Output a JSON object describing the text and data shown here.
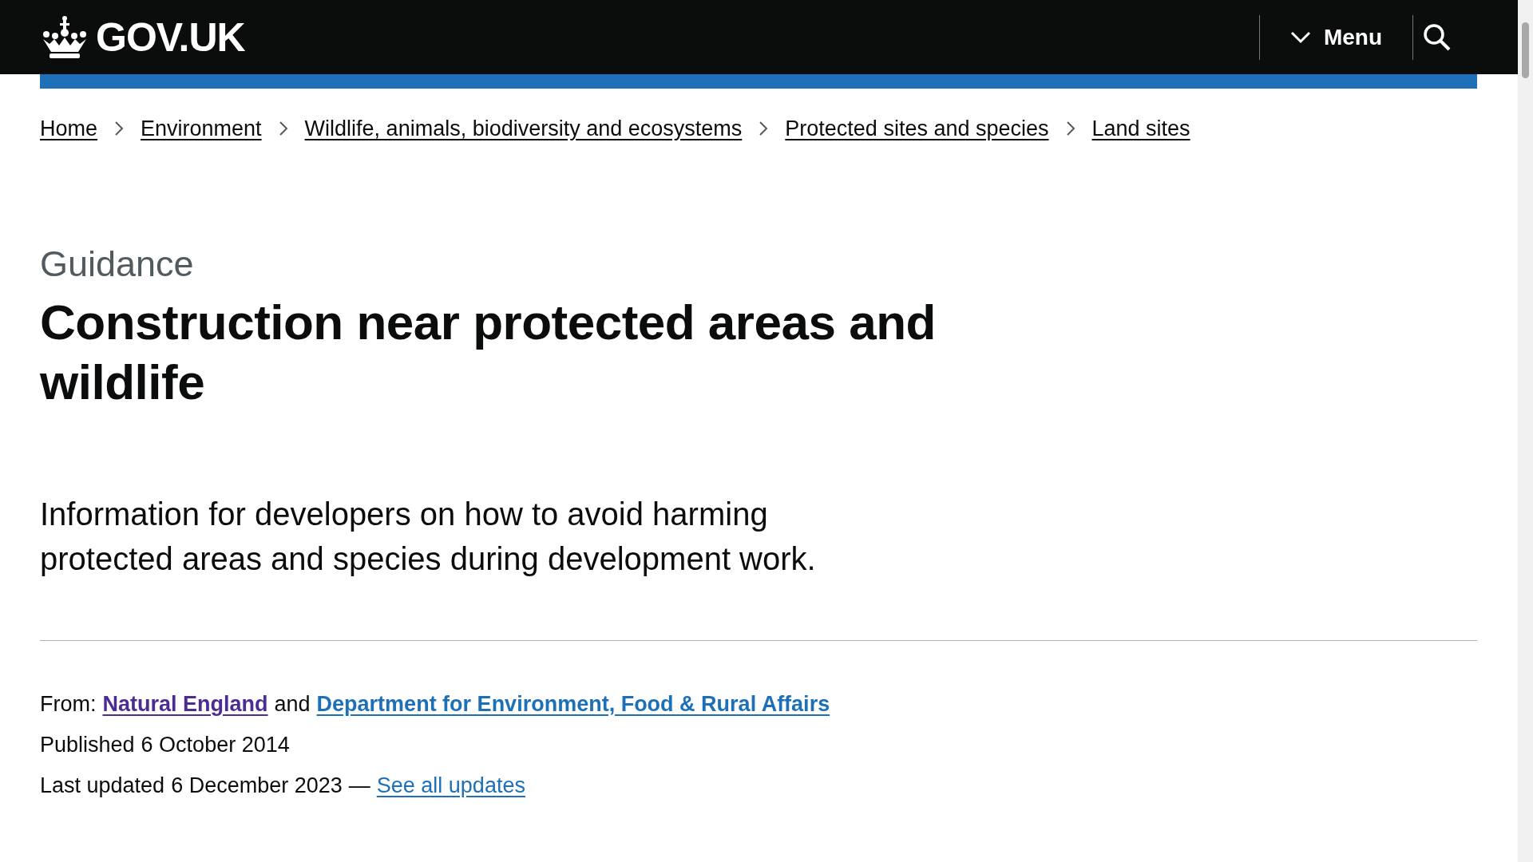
{
  "header": {
    "logo_text": "GOV.UK",
    "menu_button": "Menu"
  },
  "breadcrumbs": [
    {
      "label": "Home"
    },
    {
      "label": "Environment"
    },
    {
      "label": "Wildlife, animals, biodiversity and ecosystems"
    },
    {
      "label": "Protected sites and species"
    },
    {
      "label": "Land sites"
    }
  ],
  "caption": "Guidance",
  "title": "Construction near protected areas and wildlife",
  "lead": "Information for developers on how to avoid harming protected areas and species during development work.",
  "metadata": {
    "from_label": "From:",
    "joiner": "and",
    "organisations": [
      {
        "label": "Natural England",
        "visited": true
      },
      {
        "label": "Department for Environment, Food & Rural Affairs",
        "visited": false
      }
    ],
    "published_label": "Published",
    "published_date": "6 October 2014",
    "updated_label": "Last updated",
    "updated_date": "6 December 2023",
    "separator": "—",
    "updates_link": "See all updates"
  }
}
